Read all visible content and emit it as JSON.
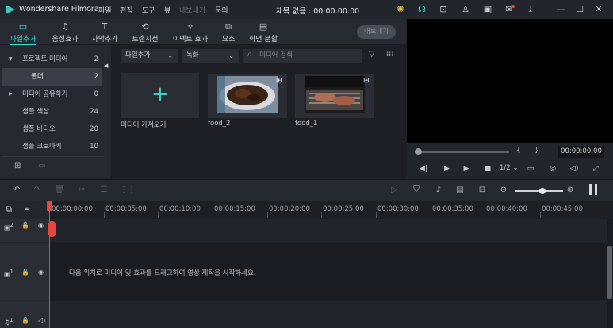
{
  "app": {
    "name": "Wondershare Filmora",
    "doc_title": "제목 없음 : 00:00:00:00"
  },
  "menu": [
    {
      "label": "파일",
      "enabled": true
    },
    {
      "label": "편집",
      "enabled": true
    },
    {
      "label": "도구",
      "enabled": true
    },
    {
      "label": "뷰",
      "enabled": true
    },
    {
      "label": "내보내기",
      "enabled": false
    },
    {
      "label": "문의",
      "enabled": true
    }
  ],
  "title_icons": [
    "bulb-icon",
    "headset-icon",
    "gift-icon",
    "account-icon",
    "save-icon",
    "mail-icon",
    "download-icon",
    "minimize-icon",
    "maximize-icon",
    "close-icon"
  ],
  "toolbar": {
    "tabs": [
      {
        "label": "파일추가",
        "icon": "folder-icon",
        "active": true
      },
      {
        "label": "음성효과",
        "icon": "music-note-icon",
        "active": false
      },
      {
        "label": "자막추가",
        "icon": "text-icon",
        "active": false
      },
      {
        "label": "트랜지션",
        "icon": "transition-icon",
        "active": false
      },
      {
        "label": "이펙트 효과",
        "icon": "effects-icon",
        "active": false
      },
      {
        "label": "요소",
        "icon": "elements-icon",
        "active": false
      },
      {
        "label": "화면 분할",
        "icon": "split-screen-icon",
        "active": false
      }
    ],
    "export_label": "내보내기"
  },
  "library": {
    "items": [
      {
        "label": "프로젝트 미디어",
        "count": "2",
        "arrow": "▼"
      },
      {
        "label": "폴더",
        "count": "2",
        "selected": true
      },
      {
        "label": "미디어 공유하기",
        "count": "0",
        "arrow": "▶"
      },
      {
        "label": "샘플 색상",
        "count": "24"
      },
      {
        "label": "샘플 비디오",
        "count": "20"
      },
      {
        "label": "샘플 크로마키",
        "count": "10"
      }
    ]
  },
  "media": {
    "filter1": "파일추가",
    "filter2": "녹화",
    "search_placeholder": "미디어 검색",
    "import_label": "미디어 가져오기",
    "clips": [
      {
        "name": "food_2"
      },
      {
        "name": "food_1"
      }
    ]
  },
  "preview": {
    "timecode": "00:00:00:00",
    "brackets": "{      }",
    "quality": "1/2"
  },
  "timeline": {
    "ticks": [
      "00:00:00:00",
      "00:00:05:00",
      "00:00:10:00",
      "00:00:15:00",
      "00:00:20:00",
      "00:00:25:00",
      "00:00:30:00",
      "00:00:35:00",
      "00:00:40:00",
      "00:00:45:00"
    ],
    "drop_hint": "다음 위치로 미디어 및 효과를 드래그하여 영상 제작을 시작하세요.",
    "tracks": [
      {
        "name": "video-track-2",
        "number": "2"
      },
      {
        "name": "video-track-1",
        "number": "1"
      },
      {
        "name": "audio-track-1",
        "number": "1"
      }
    ]
  },
  "colors": {
    "accent": "#2ee6d6",
    "playhead": "#e5473f",
    "bg": "#1e2027"
  }
}
